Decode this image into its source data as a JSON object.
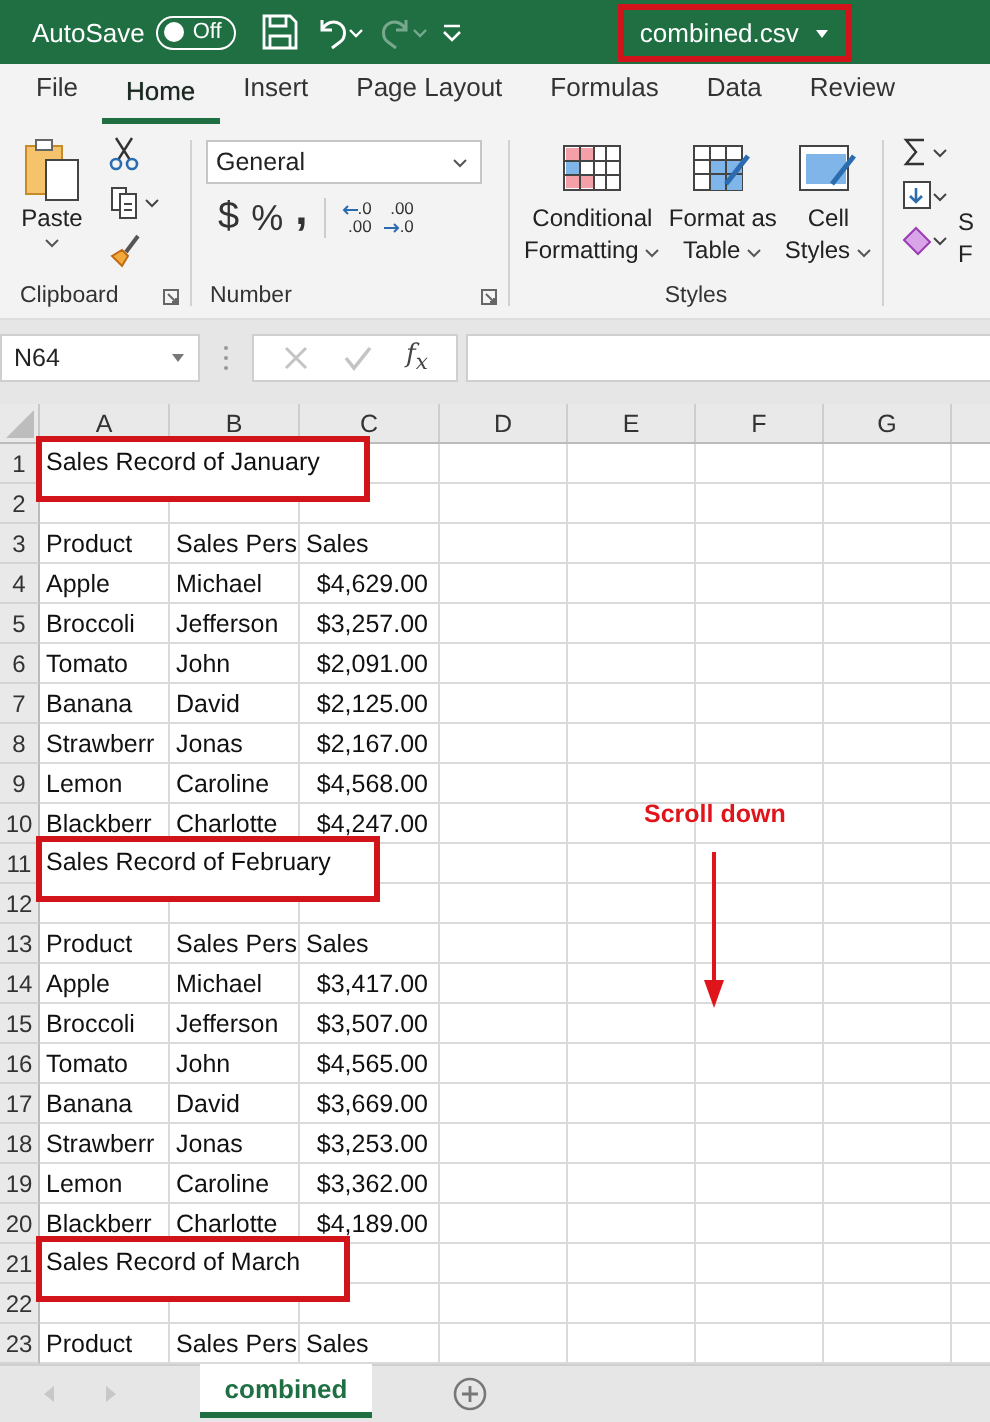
{
  "title_bar": {
    "autosave_label": "AutoSave",
    "autosave_toggle": {
      "label": "Off",
      "on": false
    },
    "redo_disabled": true,
    "file_name": "combined.csv",
    "file_name_highlighted": true
  },
  "ribbon_tabs": [
    {
      "label": "File",
      "selected": false
    },
    {
      "label": "Home",
      "selected": true
    },
    {
      "label": "Insert",
      "selected": false
    },
    {
      "label": "Page Layout",
      "selected": false
    },
    {
      "label": "Formulas",
      "selected": false
    },
    {
      "label": "Data",
      "selected": false
    },
    {
      "label": "Review",
      "selected": false
    }
  ],
  "ribbon": {
    "clipboard": {
      "paste_label": "Paste",
      "group_label": "Clipboard"
    },
    "number": {
      "format": "General",
      "symbol_buttons": [
        "$",
        "%",
        ","
      ],
      "decimal_buttons": [
        {
          "kind": "increase",
          "upper": ".0",
          "lower": ".00"
        },
        {
          "kind": "decrease",
          "upper": ".00",
          "lower": ".0"
        }
      ],
      "group_label": "Number"
    },
    "styles": {
      "buttons": [
        {
          "kind": "conditional",
          "lines": [
            "Conditional",
            "Formatting"
          ]
        },
        {
          "kind": "table",
          "lines": [
            "Format as",
            "Table"
          ]
        },
        {
          "kind": "cell",
          "lines": [
            "Cell",
            "Styles"
          ]
        }
      ],
      "group_label": "Styles"
    },
    "editing": {
      "cut_labels": [
        "S",
        "F"
      ]
    }
  },
  "formula_bar": {
    "name_box": "N64",
    "fx_label": "f$_{x}$"
  },
  "sheet": {
    "columns": [
      "A",
      "B",
      "C",
      "D",
      "E",
      "F",
      "G"
    ],
    "rows": [
      {
        "number": "1",
        "kind": "title",
        "highlighted": true,
        "cells": [
          "Sales Record of January"
        ]
      },
      {
        "number": "2",
        "kind": "blank"
      },
      {
        "number": "3",
        "kind": "header",
        "cells": [
          "Product",
          "Sales Pers",
          "Sales"
        ]
      },
      {
        "number": "4",
        "kind": "data",
        "cells": [
          "Apple",
          "Michael",
          "$4,629.00"
        ]
      },
      {
        "number": "5",
        "kind": "data",
        "cells": [
          "Broccoli",
          "Jefferson",
          "$3,257.00"
        ]
      },
      {
        "number": "6",
        "kind": "data",
        "cells": [
          "Tomato",
          "John",
          "$2,091.00"
        ]
      },
      {
        "number": "7",
        "kind": "data",
        "cells": [
          "Banana",
          "David",
          "$2,125.00"
        ]
      },
      {
        "number": "8",
        "kind": "data",
        "cells": [
          "Strawberr",
          "Jonas",
          "$2,167.00"
        ]
      },
      {
        "number": "9",
        "kind": "data",
        "cells": [
          "Lemon",
          "Caroline",
          "$4,568.00"
        ]
      },
      {
        "number": "10",
        "kind": "data",
        "cells": [
          "Blackberr",
          "Charlotte",
          "$4,247.00"
        ]
      },
      {
        "number": "11",
        "kind": "title",
        "highlighted": true,
        "cells": [
          "Sales Record of February"
        ]
      },
      {
        "number": "12",
        "kind": "blank"
      },
      {
        "number": "13",
        "kind": "header",
        "cells": [
          "Product",
          "Sales Pers",
          "Sales"
        ]
      },
      {
        "number": "14",
        "kind": "data",
        "cells": [
          "Apple",
          "Michael",
          "$3,417.00"
        ]
      },
      {
        "number": "15",
        "kind": "data",
        "cells": [
          "Broccoli",
          "Jefferson",
          "$3,507.00"
        ]
      },
      {
        "number": "16",
        "kind": "data",
        "cells": [
          "Tomato",
          "John",
          "$4,565.00"
        ]
      },
      {
        "number": "17",
        "kind": "data",
        "cells": [
          "Banana",
          "David",
          "$3,669.00"
        ]
      },
      {
        "number": "18",
        "kind": "data",
        "cells": [
          "Strawberr",
          "Jonas",
          "$3,253.00"
        ]
      },
      {
        "number": "19",
        "kind": "data",
        "cells": [
          "Lemon",
          "Caroline",
          "$3,362.00"
        ]
      },
      {
        "number": "20",
        "kind": "data",
        "cells": [
          "Blackberr",
          "Charlotte",
          "$4,189.00"
        ]
      },
      {
        "number": "21",
        "kind": "title",
        "highlighted": true,
        "cells": [
          "Sales Record of March"
        ]
      },
      {
        "number": "22",
        "kind": "blank"
      },
      {
        "number": "23",
        "kind": "header",
        "cells": [
          "Product",
          "Sales Pers",
          "Sales"
        ]
      }
    ]
  },
  "annotation": {
    "text": "Scroll down"
  },
  "sheet_tabs": [
    {
      "label": "combined",
      "selected": true
    }
  ]
}
